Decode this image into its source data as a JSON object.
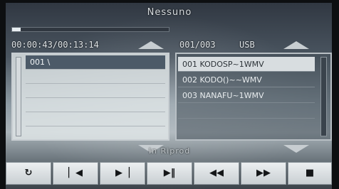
{
  "header": {
    "title": "Nessuno"
  },
  "playback": {
    "time": "00:00:43/00:13:14",
    "progress_fraction": 0.055
  },
  "files_info": {
    "count": "001/003",
    "source": "USB"
  },
  "folders": {
    "items": [
      "001 \\",
      "",
      "",
      "",
      "",
      ""
    ]
  },
  "files": {
    "items": [
      "001 KODOSP~1WMV",
      "002 KODO()~~WMV",
      "003 NANAFU~1WMV",
      "",
      ""
    ]
  },
  "status": {
    "text": "In Riprod"
  },
  "controls": {
    "repeat": "↻",
    "prev": "▏◀",
    "next": "▶▕",
    "play_pause": "▶‖",
    "rewind": "◀◀",
    "fast_forward": "▶▶",
    "stop": "■"
  }
}
